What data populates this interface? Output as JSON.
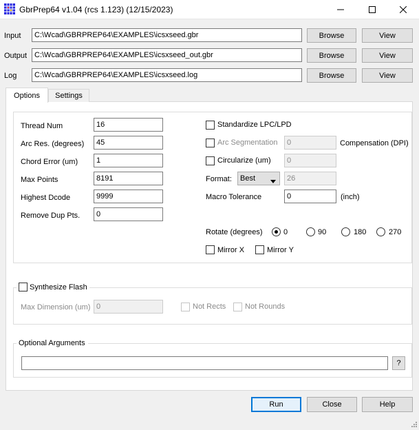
{
  "window": {
    "title": "GbrPrep64 v1.04 (rcs 1.123) (12/15/2023)",
    "icon": "app-grid-icon",
    "controls": [
      "minimize-icon",
      "maximize-icon",
      "close-icon"
    ]
  },
  "files": {
    "input": {
      "label": "Input",
      "value": "C:\\Wcad\\GBRPREP64\\EXAMPLES\\icsxseed.gbr",
      "browse": "Browse",
      "view": "View"
    },
    "output": {
      "label": "Output",
      "value": "C:\\Wcad\\GBRPREP64\\EXAMPLES\\icsxseed_out.gbr",
      "browse": "Browse",
      "view": "View"
    },
    "log": {
      "label": "Log",
      "value": "C:\\Wcad\\GBRPREP64\\EXAMPLES\\icsxseed.log",
      "browse": "Browse",
      "view": "View"
    }
  },
  "tabs": [
    {
      "label": "Options",
      "active": true
    },
    {
      "label": "Settings",
      "active": false
    }
  ],
  "options": {
    "thread_num": {
      "label": "Thread Num",
      "value": "16"
    },
    "arc_res": {
      "label": "Arc Res. (degrees)",
      "value": "45"
    },
    "chord_error": {
      "label": "Chord Error (um)",
      "value": "1"
    },
    "max_points": {
      "label": "Max Points",
      "value": "8191"
    },
    "highest_dcode": {
      "label": "Highest Dcode",
      "value": "9999"
    },
    "remove_dup": {
      "label": "Remove Dup Pts.",
      "value": "0"
    },
    "standardize": {
      "label": "Standardize LPC/LPD",
      "checked": false
    },
    "arc_segmentation": {
      "label": "Arc Segmentation",
      "checked": false,
      "value": "0",
      "suffix": "Compensation (DPI)"
    },
    "circularize": {
      "label": "Circularize (um)",
      "checked": false,
      "value": "0"
    },
    "format": {
      "label": "Format:",
      "selected": "Best",
      "value": "26"
    },
    "macro_tolerance": {
      "label": "Macro Tolerance",
      "value": "0",
      "suffix": "(inch)"
    },
    "rotate": {
      "label": "Rotate (degrees)",
      "options": [
        "0",
        "90",
        "180",
        "270"
      ],
      "selected": "0"
    },
    "mirror_x": {
      "label": "Mirror X",
      "checked": false
    },
    "mirror_y": {
      "label": "Mirror Y",
      "checked": false
    }
  },
  "synthesize": {
    "label": "Synthesize Flash",
    "checked": false,
    "max_dimension": {
      "label": "Max Dimension (um)",
      "value": "0"
    },
    "not_rects": "Not Rects",
    "not_rounds": "Not Rounds"
  },
  "optional_args": {
    "label": "Optional Arguments",
    "value": "",
    "help": "?"
  },
  "footer": {
    "run": "Run",
    "close": "Close",
    "help": "Help"
  },
  "colors": {
    "accent": "#0078d7"
  }
}
